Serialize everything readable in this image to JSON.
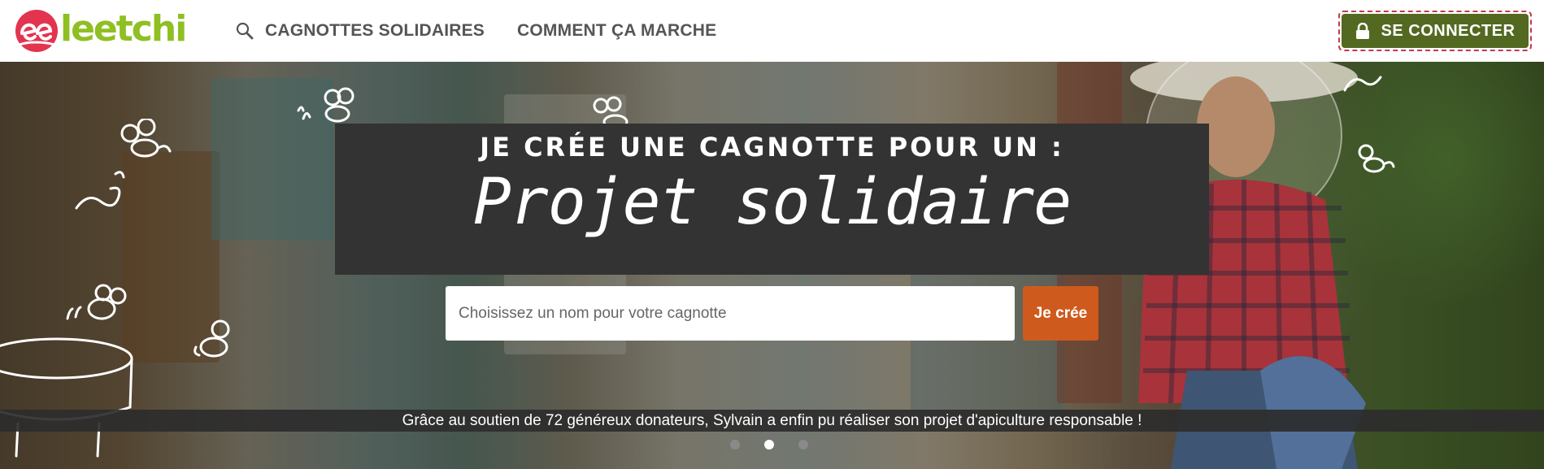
{
  "header": {
    "logo_text": "leetchi",
    "nav": [
      {
        "label": "CAGNOTTES SOLIDAIRES",
        "icon": "search-icon"
      },
      {
        "label": "COMMENT ÇA MARCHE"
      }
    ],
    "login_label": "SE CONNECTER",
    "login_icon": "lock-icon"
  },
  "hero": {
    "title_small": "JE CRÉE UNE CAGNOTTE POUR UN :",
    "title_big": "Projet solidaire",
    "input_placeholder": "Choisissez un nom pour votre cagnotte",
    "input_value": "",
    "create_label": "Je crée",
    "caption": "Grâce au soutien de 72 généreux donateurs, Sylvain a enfin pu réaliser son projet d'apiculture responsable !",
    "carousel": {
      "count": 3,
      "active": 2
    }
  },
  "colors": {
    "brand_green": "#8fbf22",
    "brand_red": "#e3344f",
    "login_bg": "#536921",
    "create_bg": "#cf5a1e"
  }
}
